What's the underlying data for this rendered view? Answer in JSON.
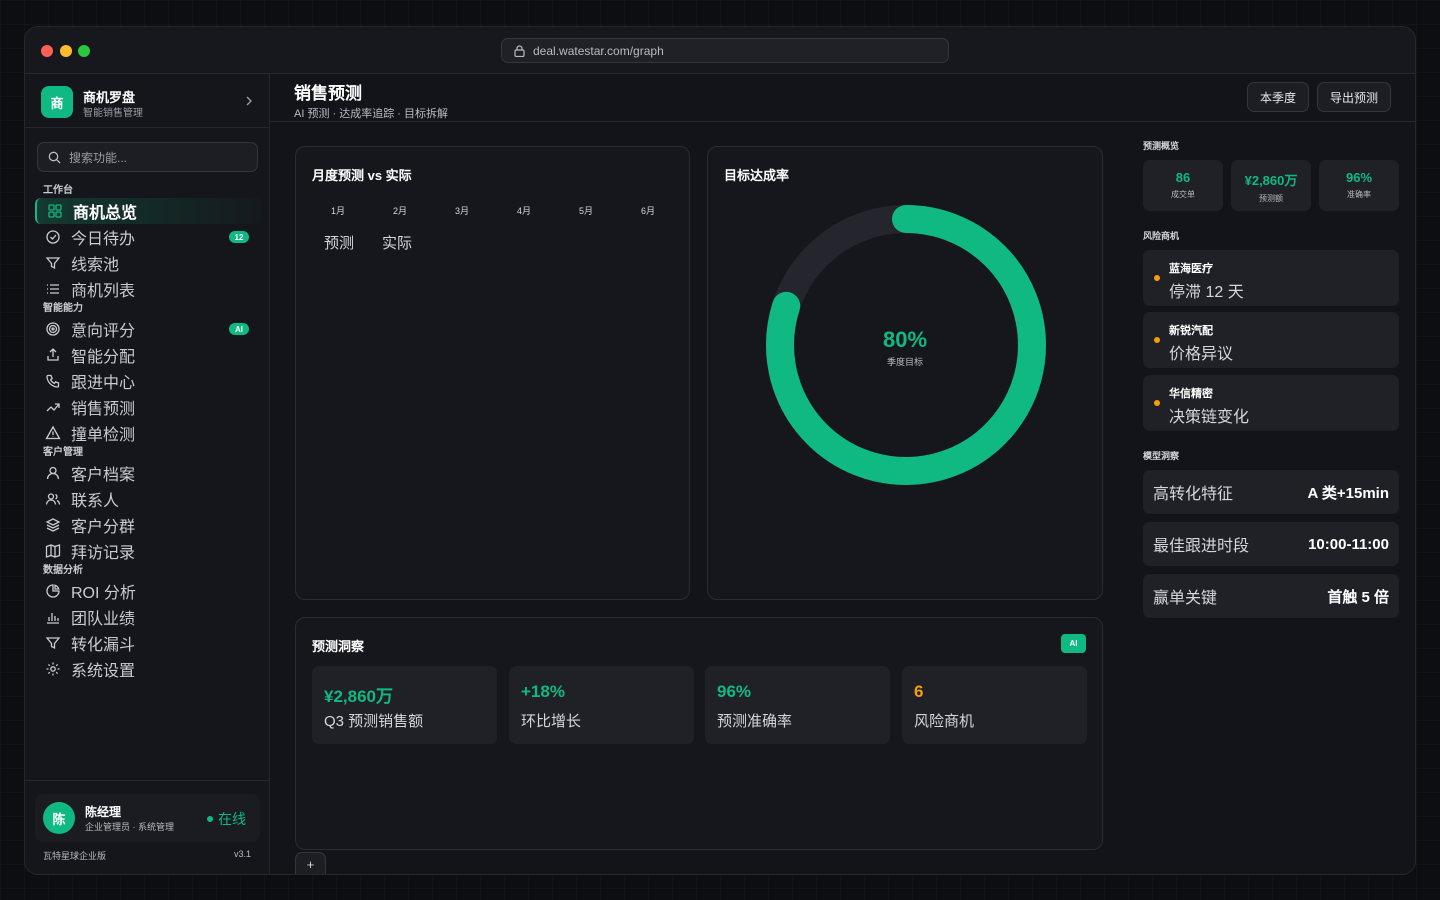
{
  "browser": {
    "url": "deal.watestar.com/graph"
  },
  "brand": {
    "logo_char": "商",
    "name": "商机罗盘",
    "subtitle": "智能销售管理"
  },
  "search": {
    "placeholder": "搜索功能..."
  },
  "nav": {
    "sections": [
      {
        "label": "工作台",
        "items": [
          {
            "label": "商机总览",
            "icon": "grid-icon",
            "active": true
          },
          {
            "label": "今日待办",
            "icon": "check-circle-icon",
            "badge": "12"
          },
          {
            "label": "线索池",
            "icon": "filter-icon"
          },
          {
            "label": "商机列表",
            "icon": "list-icon"
          }
        ]
      },
      {
        "label": "智能能力",
        "items": [
          {
            "label": "意向评分",
            "icon": "target-icon",
            "badge": "AI"
          },
          {
            "label": "智能分配",
            "icon": "share-icon"
          },
          {
            "label": "跟进中心",
            "icon": "phone-icon"
          },
          {
            "label": "销售预测",
            "icon": "trend-icon"
          },
          {
            "label": "撞单检测",
            "icon": "warning-icon"
          }
        ]
      },
      {
        "label": "客户管理",
        "items": [
          {
            "label": "客户档案",
            "icon": "user-icon"
          },
          {
            "label": "联系人",
            "icon": "users-icon"
          },
          {
            "label": "客户分群",
            "icon": "layers-icon"
          },
          {
            "label": "拜访记录",
            "icon": "map-icon"
          }
        ]
      },
      {
        "label": "数据分析",
        "items": [
          {
            "label": "ROI 分析",
            "icon": "pie-icon"
          },
          {
            "label": "团队业绩",
            "icon": "bar-chart-icon"
          },
          {
            "label": "转化漏斗",
            "icon": "funnel-icon"
          },
          {
            "label": "系统设置",
            "icon": "gear-icon"
          }
        ]
      }
    ]
  },
  "user": {
    "avatar_char": "陈",
    "name": "陈经理",
    "role": "企业管理员 · 系统管理",
    "status": "在线"
  },
  "footer": {
    "edition": "瓦特星球企业版",
    "version": "v3.1"
  },
  "header": {
    "title": "销售预测",
    "subtitle": "AI 预测 · 达成率追踪 · 目标拆解",
    "btn_quarter": "本季度",
    "btn_export": "导出预测"
  },
  "monthly_card": {
    "title": "月度预测 vs 实际",
    "months": [
      "1月",
      "2月",
      "3月",
      "4月",
      "5月",
      "6月"
    ],
    "legend": [
      "预测",
      "实际"
    ]
  },
  "goal_card": {
    "title": "目标达成率",
    "value_text": "80%",
    "label": "季度目标",
    "progress": 0.8
  },
  "insight_card": {
    "title": "预测洞察",
    "tag": "AI",
    "tiles": [
      {
        "value": "¥2,860万",
        "label": "Q3 预测销售额",
        "accent": "green"
      },
      {
        "value": "+18%",
        "label": "环比增长",
        "accent": "green"
      },
      {
        "value": "96%",
        "label": "预测准确率",
        "accent": "green"
      },
      {
        "value": "6",
        "label": "风险商机",
        "accent": "orange"
      }
    ]
  },
  "add_tab": "+",
  "right_panel": {
    "overview_title": "预测概览",
    "stats": [
      {
        "value": "86",
        "label": "成交单"
      },
      {
        "value": "¥2,860万",
        "label": "预测额"
      },
      {
        "value": "96%",
        "label": "准确率"
      }
    ],
    "risk_title": "风险商机",
    "risks": [
      {
        "name": "蓝海医疗",
        "desc": "停滞 12 天"
      },
      {
        "name": "新锐汽配",
        "desc": "价格异议"
      },
      {
        "name": "华信精密",
        "desc": "决策链变化"
      }
    ],
    "model_title": "模型洞察",
    "models": [
      {
        "key": "高转化特征",
        "value": "A 类+15min"
      },
      {
        "key": "最佳跟进时段",
        "value": "10:00-11:00"
      },
      {
        "key": "赢单关键",
        "value": "首触 5 倍"
      }
    ]
  },
  "colors": {
    "accent": "#10b981",
    "warning": "#f59e0b",
    "bg": "#131419"
  }
}
